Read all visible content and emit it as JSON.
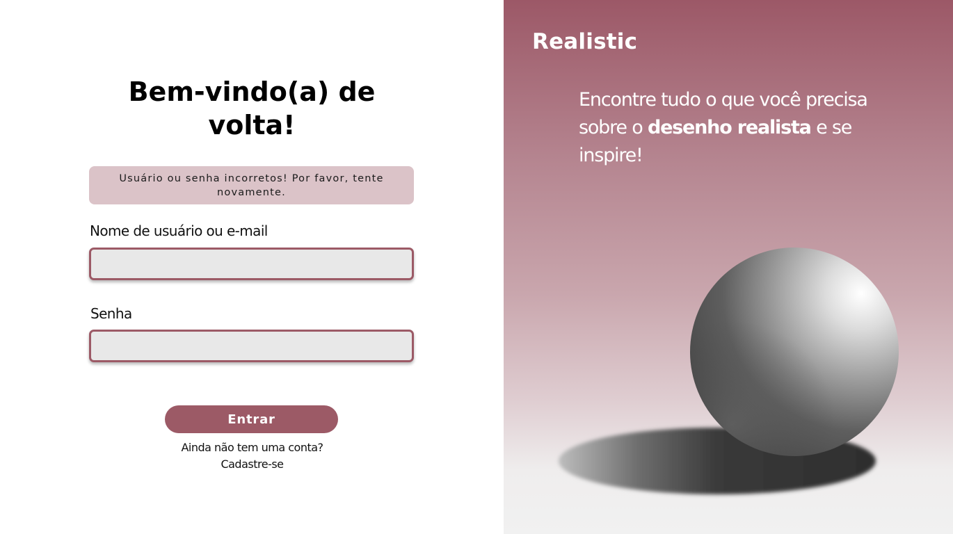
{
  "login": {
    "title": "Bem-vindo(a) de volta!",
    "error_message": "Usuário ou senha incorretos! Por favor, tente novamente.",
    "username_label": "Nome de usuário ou e-mail",
    "username_value": "",
    "password_label": "Senha",
    "password_value": "",
    "submit_label": "Entrar",
    "signup_prompt": "Ainda não tem uma conta?",
    "signup_link": "Cadastre-se"
  },
  "promo": {
    "brand": "Realistic",
    "tagline_before": "Encontre tudo o que você precisa sobre o ",
    "tagline_highlight": "desenho realista",
    "tagline_after": " e se inspire!",
    "illustration": "shaded-sphere-with-shadow"
  },
  "colors": {
    "accent": "#9c5a66",
    "error_background": "#dbc3c8",
    "input_background": "#e8e8e8"
  }
}
